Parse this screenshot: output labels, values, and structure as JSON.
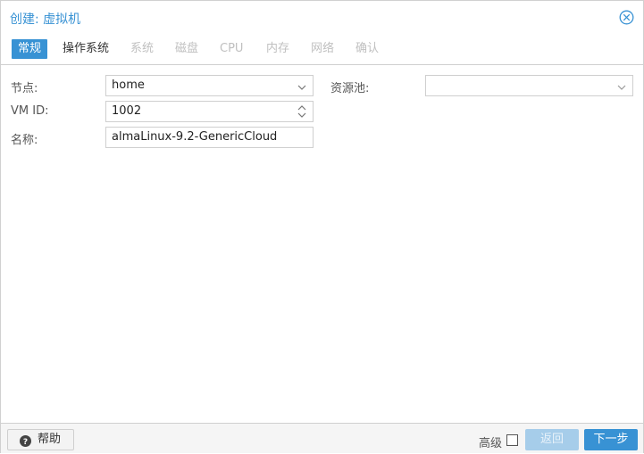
{
  "dialog": {
    "title": "创建: 虚拟机",
    "close_icon": "close-circle-icon"
  },
  "tabs": [
    {
      "label": "常规",
      "state": "active"
    },
    {
      "label": "操作系统",
      "state": "enabled"
    },
    {
      "label": "系统",
      "state": "disabled"
    },
    {
      "label": "磁盘",
      "state": "disabled"
    },
    {
      "label": "CPU",
      "state": "disabled"
    },
    {
      "label": "内存",
      "state": "disabled"
    },
    {
      "label": "网络",
      "state": "disabled"
    },
    {
      "label": "确认",
      "state": "disabled"
    }
  ],
  "form": {
    "node": {
      "label": "节点:",
      "value": "home"
    },
    "vmid": {
      "label": "VM ID:",
      "value": "1002"
    },
    "name": {
      "label": "名称:",
      "value": "almaLinux-9.2-GenericCloud"
    },
    "pool": {
      "label": "资源池:",
      "value": ""
    }
  },
  "footer": {
    "help_label": "帮助",
    "advanced_label": "高级",
    "advanced_checked": false,
    "back_label": "返回",
    "next_label": "下一步"
  },
  "colors": {
    "accent": "#3892d4",
    "disabled_button": "#a6cdea"
  }
}
